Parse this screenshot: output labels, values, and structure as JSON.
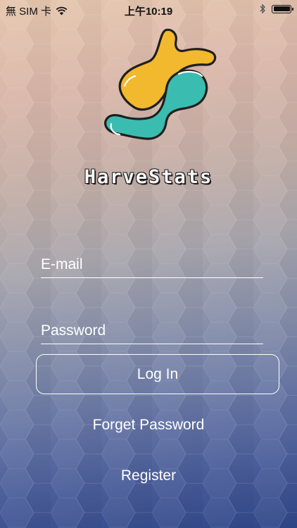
{
  "status_bar": {
    "carrier": "無 SIM 卡",
    "time": "上午10:19",
    "icons": [
      "wifi-icon",
      "bluetooth-icon",
      "battery-icon"
    ]
  },
  "brand": {
    "name": "HarveStats"
  },
  "colors": {
    "logo_yellow": "#f2b82e",
    "logo_teal": "#3bbcb0",
    "outline": "#1f1f1f"
  },
  "form": {
    "email_placeholder": "E-mail",
    "email_value": "",
    "password_placeholder": "Password",
    "password_value": "",
    "login_label": "Log In",
    "forget_label": "Forget Password",
    "register_label": "Register"
  }
}
